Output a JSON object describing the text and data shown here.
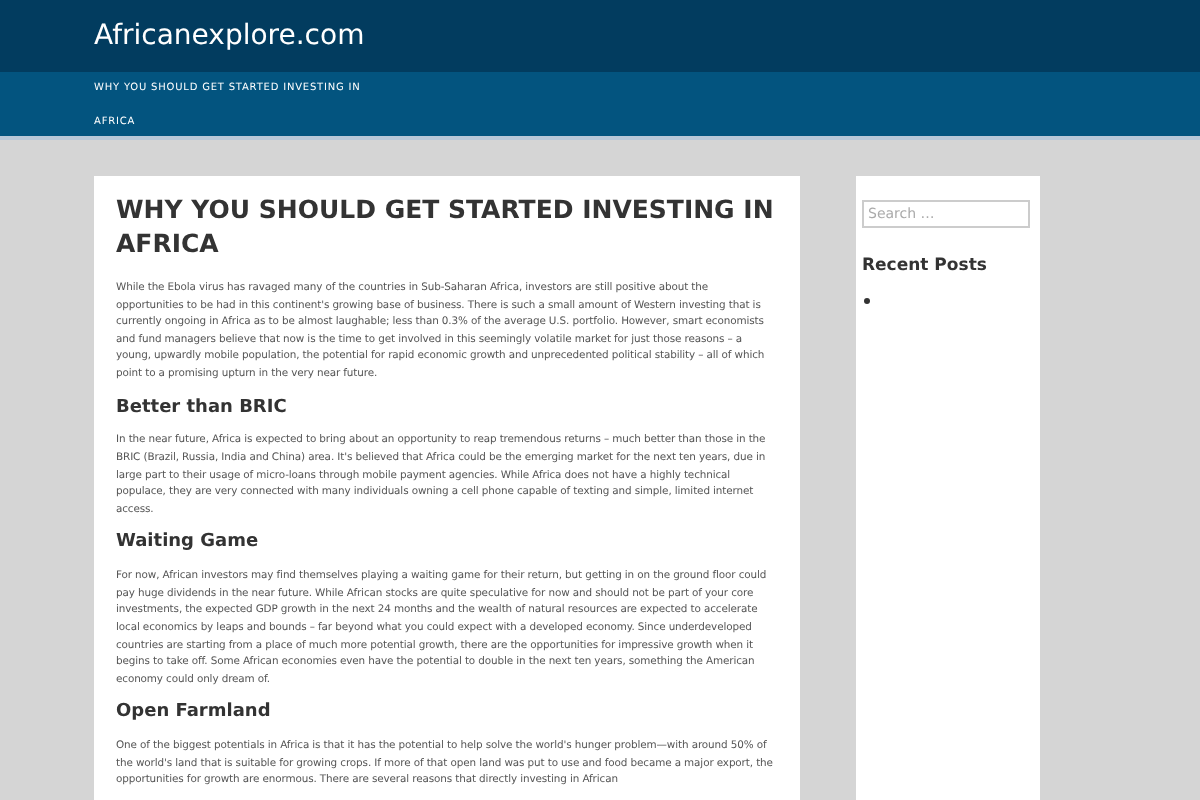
{
  "site_title": "Africanexplore.com",
  "nav": [
    {
      "label": "WHY YOU SHOULD GET STARTED INVESTING IN"
    },
    {
      "label": "AFRICA"
    }
  ],
  "article": {
    "title": "WHY YOU SHOULD GET STARTED INVESTING IN AFRICA",
    "blocks": [
      {
        "kind": "paragraph",
        "text": "While the Ebola virus has ravaged many of the countries in Sub-Saharan Africa, investors are still positive about the opportunities to be had in this continent's growing base of business. There is such a small amount of Western investing that is currently ongoing in Africa as to be almost laughable; less than 0.3% of the average U.S. portfolio. However, smart economists and fund managers believe that now is the time to get involved in this seemingly volatile market for just those reasons – a young, upwardly mobile population, the potential for rapid economic growth and unprecedented political stability – all of which point to a promising upturn in the very near future."
      },
      {
        "kind": "heading",
        "text": "Better than BRIC"
      },
      {
        "kind": "paragraph",
        "text": "In the near future, Africa is expected to bring about an opportunity to reap tremendous returns – much better than those in the BRIC (Brazil, Russia, India and China) area. It's believed that Africa could be the emerging market for the next ten years, due in large part to their usage of micro-loans through mobile payment agencies. While Africa does not have a highly technical populace, they are very connected with many individuals owning a cell phone capable of texting and simple, limited internet access."
      },
      {
        "kind": "heading",
        "text": "Waiting Game"
      },
      {
        "kind": "paragraph",
        "text": "For now, African investors may find themselves playing a waiting game for their return, but getting in on the ground floor could pay huge dividends in the near future. While African stocks are quite speculative for now and should not be part of your core investments, the expected GDP growth in the next 24 months and the wealth of natural resources are expected to accelerate local economics by leaps and bounds – far beyond what you could expect with a developed economy. Since underdeveloped countries are starting from a place of much more potential growth, there are the opportunities for impressive growth when it begins to take off. Some African economies even have the potential to double in the next ten years, something the American economy could only dream of."
      },
      {
        "kind": "heading",
        "text": "Open Farmland"
      },
      {
        "kind": "paragraph",
        "text": "One of the biggest potentials in Africa is that it has the potential to help solve the world's hunger problem—with around 50% of the world's land that is suitable for growing crops. If more of that open land was put to use and food became a major export, the opportunities for growth are enormous. There are several reasons that directly investing in African"
      }
    ]
  },
  "sidebar": {
    "search": {
      "placeholder": "Search …"
    },
    "recent_posts_title": "Recent Posts"
  }
}
